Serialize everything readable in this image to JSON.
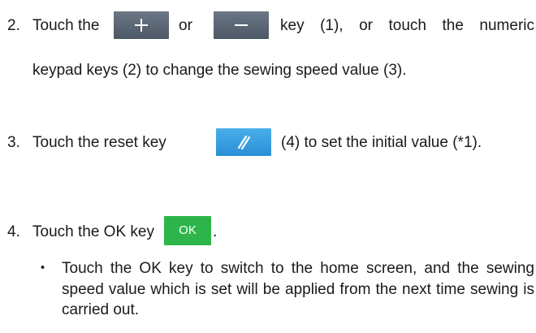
{
  "steps": [
    {
      "number": "2.",
      "text_before_plus": "Touch the",
      "text_between_keys": "or",
      "text_after_minus": "key (1), or touch the numeric",
      "continuation": "keypad keys (2) to change the sewing speed value (3)."
    },
    {
      "number": "3.",
      "text_before_key": "Touch the reset key",
      "text_after_key": "(4) to set the initial value (*1)."
    },
    {
      "number": "4.",
      "text_before_key": "Touch the OK key",
      "ok_key_label": "OK",
      "text_after_key": "."
    }
  ],
  "note": {
    "bullet": "・",
    "text": "Touch the OK key to switch to the home screen, and the sewing speed value which is set will be applied from the next time sewing is carried out."
  },
  "colors": {
    "plus_minus_key": "#5a6674",
    "reset_key": "#3aa0e2",
    "ok_key": "#2db54a"
  },
  "icons": {
    "plus_key": "plus-icon",
    "minus_key": "minus-icon",
    "reset_key": "reset-slashes-icon"
  }
}
